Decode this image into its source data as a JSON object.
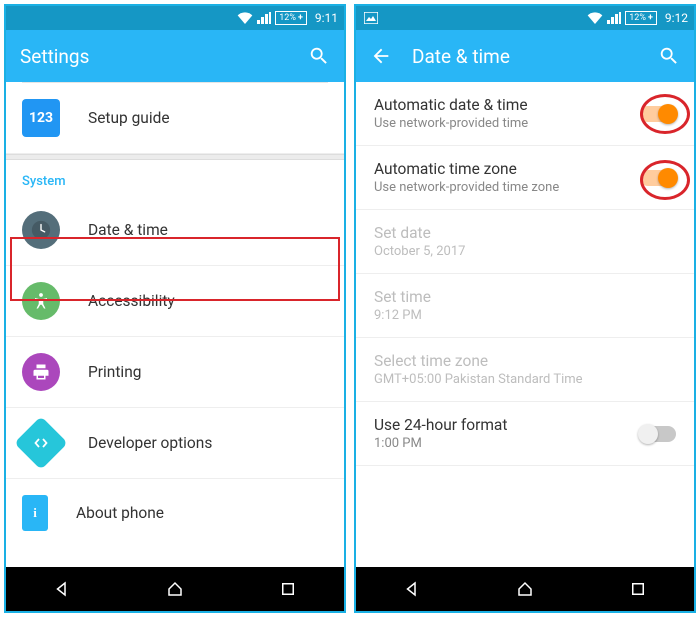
{
  "left": {
    "statusbar": {
      "battery": "12%",
      "time": "9:11"
    },
    "appbar": {
      "title": "Settings"
    },
    "setup_guide": "Setup guide",
    "system_header": "System",
    "items": {
      "date_time": "Date & time",
      "accessibility": "Accessibility",
      "printing": "Printing",
      "dev_options": "Developer options",
      "about_phone": "About phone"
    }
  },
  "right": {
    "statusbar": {
      "battery": "12%",
      "time": "9:12"
    },
    "appbar": {
      "title": "Date & time"
    },
    "rows": {
      "auto_dt": {
        "title": "Automatic date & time",
        "sub": "Use network-provided time",
        "on": true
      },
      "auto_tz": {
        "title": "Automatic time zone",
        "sub": "Use network-provided time zone",
        "on": true
      },
      "set_date": {
        "title": "Set date",
        "sub": "October 5, 2017"
      },
      "set_time": {
        "title": "Set time",
        "sub": "9:12 PM"
      },
      "select_tz": {
        "title": "Select time zone",
        "sub": "GMT+05:00 Pakistan Standard Time"
      },
      "use_24h": {
        "title": "Use 24-hour format",
        "sub": "1:00 PM",
        "on": false
      }
    }
  }
}
